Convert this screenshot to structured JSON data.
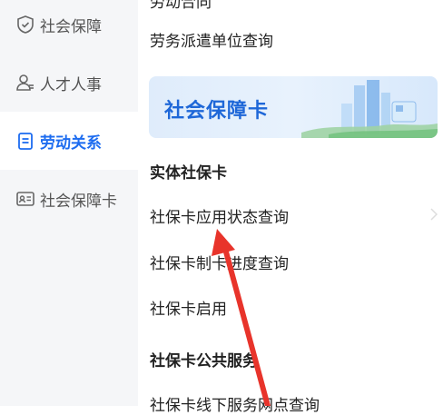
{
  "sidebar": {
    "items": [
      {
        "label": "社会保障",
        "icon": "shield-check-icon",
        "active": false
      },
      {
        "label": "人才人事",
        "icon": "person-icon",
        "active": false
      },
      {
        "label": "劳动关系",
        "icon": "document-icon",
        "active": true
      },
      {
        "label": "社会保障卡",
        "icon": "id-card-icon",
        "active": false
      }
    ]
  },
  "content": {
    "top_cut_text": "劳动合同",
    "first_row": "劳务派遣单位查询",
    "banner_title": "社会保障卡",
    "section1": {
      "title": "实体社保卡",
      "items": [
        "社保卡应用状态查询",
        "社保卡制卡进度查询",
        "社保卡启用"
      ]
    },
    "section2": {
      "title": "社保卡公共服务",
      "items": [
        "社保卡线下服务网点查询"
      ]
    }
  },
  "colors": {
    "accent": "#1d6cf0",
    "sidebar_bg": "#f5f6f8",
    "annotation": "#e8342b"
  }
}
